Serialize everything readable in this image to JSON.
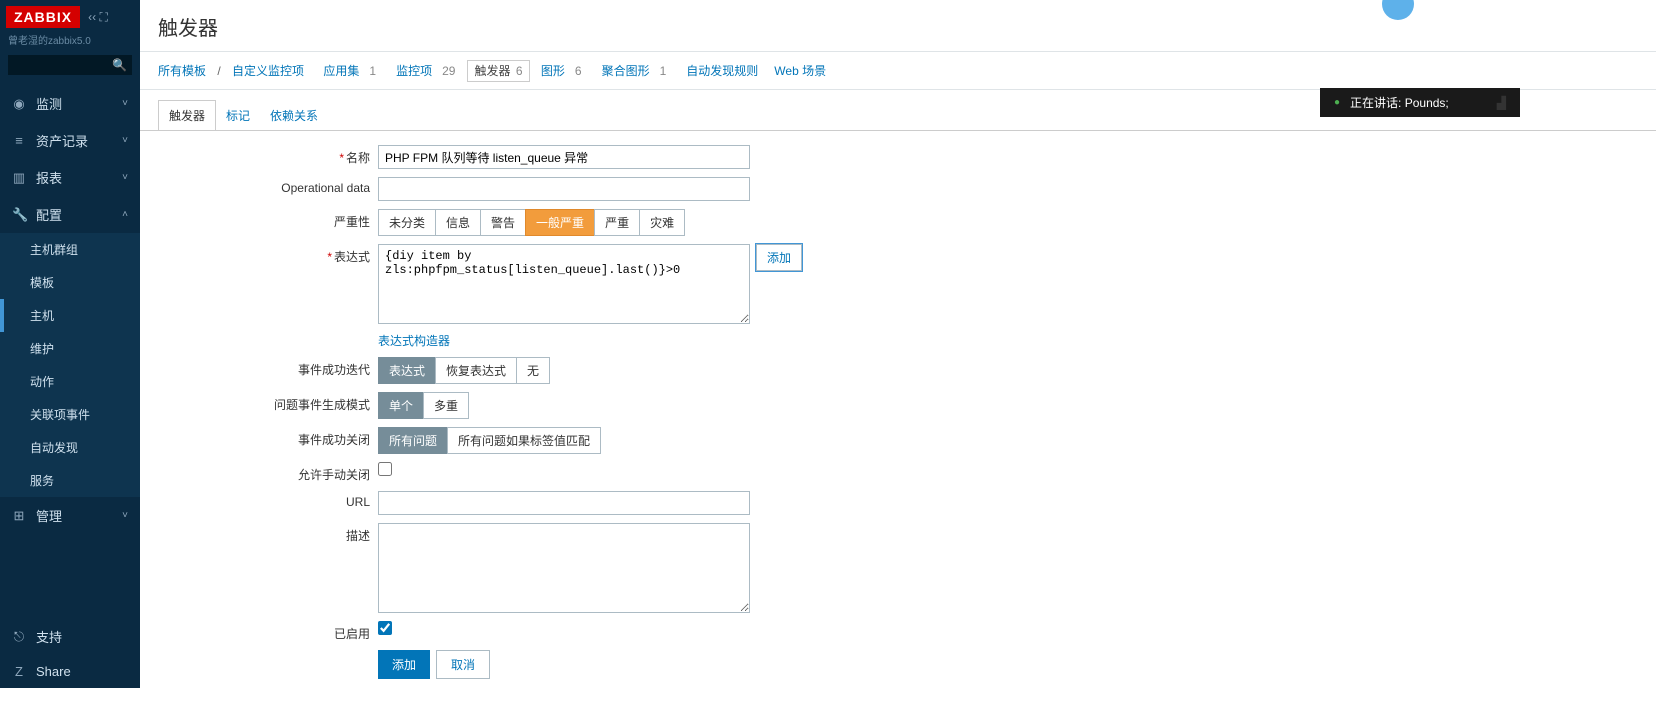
{
  "sidebar": {
    "logo": "ZABBIX",
    "userline": "曾老湿的zabbix5.0",
    "sections": [
      {
        "icon": "◉",
        "label": "监测",
        "expanded": false
      },
      {
        "icon": "≡",
        "label": "资产记录",
        "expanded": false
      },
      {
        "icon": "▥",
        "label": "报表",
        "expanded": false
      },
      {
        "icon": "🔧",
        "label": "配置",
        "expanded": true,
        "items": [
          {
            "label": "主机群组",
            "active": false
          },
          {
            "label": "模板",
            "active": false
          },
          {
            "label": "主机",
            "active": true
          },
          {
            "label": "维护",
            "active": false
          },
          {
            "label": "动作",
            "active": false
          },
          {
            "label": "关联项事件",
            "active": false
          },
          {
            "label": "自动发现",
            "active": false
          },
          {
            "label": "服务",
            "active": false
          }
        ]
      },
      {
        "icon": "⊞",
        "label": "管理",
        "expanded": false
      }
    ],
    "footer": [
      {
        "icon": "⎋",
        "label": "支持"
      },
      {
        "icon": "Z",
        "label": "Share"
      }
    ]
  },
  "page": {
    "title": "触发器",
    "topline": {
      "allTemplates": "所有模板",
      "customItem": "自定义监控项",
      "links": [
        {
          "label": "应用集",
          "count": "1"
        },
        {
          "label": "监控项",
          "count": "29"
        },
        {
          "label": "触发器",
          "count": "6",
          "active": true
        },
        {
          "label": "图形",
          "count": "6"
        },
        {
          "label": "聚合图形",
          "count": "1"
        },
        {
          "label": "自动发现规则",
          "count": ""
        },
        {
          "label": "Web 场景",
          "count": ""
        }
      ]
    },
    "tabs": [
      {
        "label": "触发器",
        "active": true
      },
      {
        "label": "标记",
        "active": false
      },
      {
        "label": "依赖关系",
        "active": false
      }
    ]
  },
  "form": {
    "name_label": "名称",
    "name_value": "PHP FPM 队列等待 listen_queue 异常",
    "opdata_label": "Operational data",
    "opdata_value": "",
    "severity_label": "严重性",
    "severity_opts": [
      "未分类",
      "信息",
      "警告",
      "一般严重",
      "严重",
      "灾难"
    ],
    "expr_label": "表达式",
    "expr_value": "{diy item by zls:phpfpm_status[listen_queue].last()}>0",
    "add_btn": "添加",
    "expr_constructor": "表达式构造器",
    "okgen_label": "事件成功迭代",
    "okgen_opts": [
      "表达式",
      "恢复表达式",
      "无"
    ],
    "probgen_label": "问题事件生成模式",
    "probgen_opts": [
      "单个",
      "多重"
    ],
    "okclose_label": "事件成功关闭",
    "okclose_opts": [
      "所有问题",
      "所有问题如果标签值匹配"
    ],
    "manual_label": "允许手动关闭",
    "url_label": "URL",
    "url_value": "",
    "desc_label": "描述",
    "desc_value": "",
    "enabled_label": "已启用",
    "submit": "添加",
    "cancel": "取消"
  },
  "speaking": {
    "text": "正在讲话: Pounds;"
  }
}
